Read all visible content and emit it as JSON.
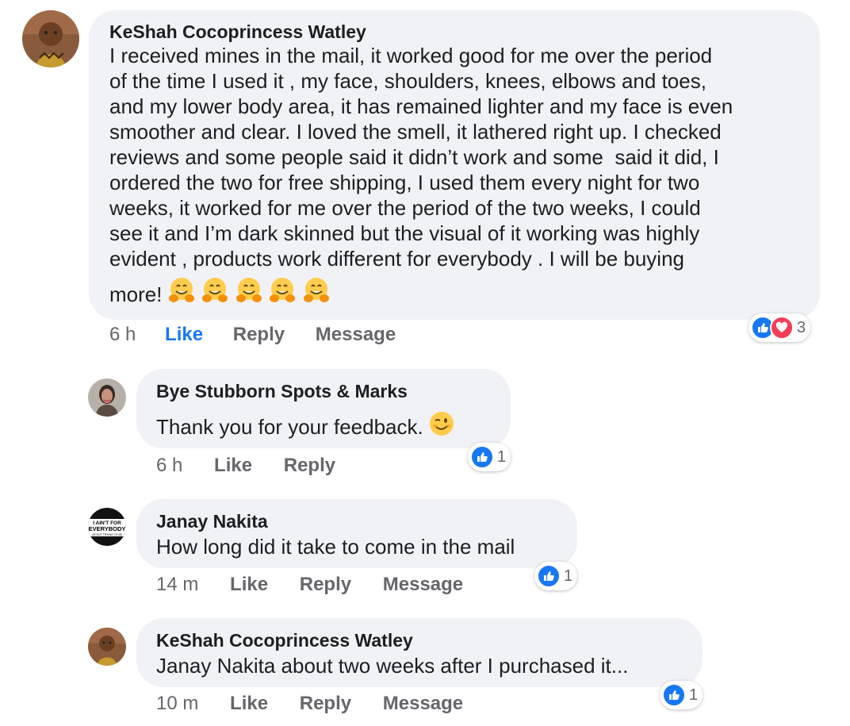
{
  "comments": [
    {
      "author": "KeShah Cocoprincess Watley",
      "text_lines": [
        "I received mines in the mail, it worked good for me over the period",
        "of the time I used it , my face, shoulders, knees, elbows and toes,",
        "and my lower body area, it has remained lighter and my face is even",
        "smoother and clear. I loved the smell, it lathered right up. I checked",
        "reviews and some people said it didn’t work and some  said it did, I",
        "ordered the two for free shipping, I used them every night for two",
        "weeks, it worked for me over the period of the two weeks, I could",
        "see it and I’m dark skinned but the visual of it working was highly",
        "evident , products work different for everybody . I will be buying",
        "more!"
      ],
      "emoji": [
        "hugging-face",
        "hugging-face",
        "hugging-face",
        "hugging-face",
        "hugging-face"
      ],
      "time": "6 h",
      "actions": [
        "Like",
        "Reply",
        "Message"
      ],
      "reactions": [
        "like",
        "love"
      ],
      "reaction_count": "3"
    },
    {
      "author": "Bye Stubborn Spots & Marks",
      "text": "Thank you for your feedback.",
      "emoji": [
        "winking-face"
      ],
      "time": "6 h",
      "actions": [
        "Like",
        "Reply"
      ],
      "reactions": [
        "like"
      ],
      "reaction_count": "1"
    },
    {
      "author": "Janay Nakita",
      "text": "How long did it take to come in the mail",
      "avatar_text": [
        "I AIN'T FOR",
        "EVERYBODY",
        "I'M NOT TRYING TO BE"
      ],
      "time": "14 m",
      "actions": [
        "Like",
        "Reply",
        "Message"
      ],
      "reactions": [
        "like"
      ],
      "reaction_count": "1"
    },
    {
      "author": "KeShah Cocoprincess Watley",
      "text": "Janay Nakita about two weeks after I purchased it...",
      "time": "10 m",
      "actions": [
        "Like",
        "Reply",
        "Message"
      ],
      "reactions": [
        "like"
      ],
      "reaction_count": "1"
    }
  ],
  "colors": {
    "bubble": "#f0f2f5",
    "meta_text": "#65676b",
    "like_blue": "#1877f2",
    "love_red": "#f33e58"
  }
}
